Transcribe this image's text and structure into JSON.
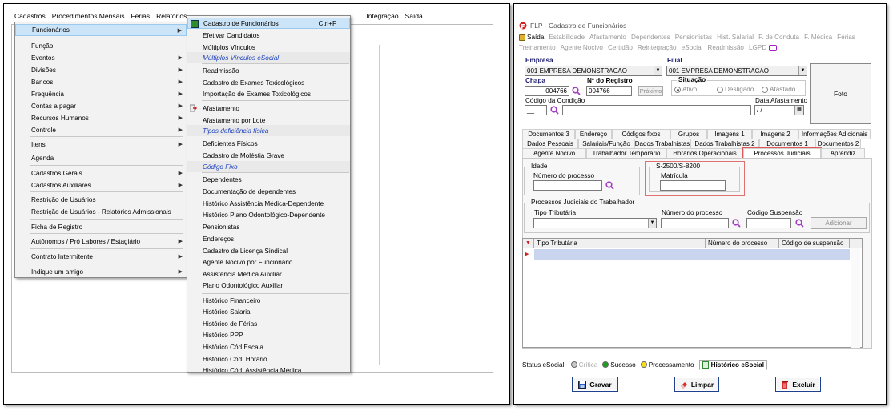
{
  "left_app": {
    "menubar": [
      "Cadastros",
      "Procedimentos Mensais",
      "Férias",
      "Relatórios",
      "Integração",
      "Saída"
    ],
    "menu1": [
      {
        "label": "Funcionários",
        "arrow": true,
        "selected": true
      },
      {
        "label": "Função"
      },
      {
        "label": "Eventos",
        "arrow": true
      },
      {
        "label": "Divisões",
        "arrow": true
      },
      {
        "label": "Bancos",
        "arrow": true
      },
      {
        "label": "Frequência",
        "arrow": true
      },
      {
        "label": "Contas a pagar",
        "arrow": true
      },
      {
        "label": "Recursos Humanos",
        "arrow": true
      },
      {
        "label": "Controle",
        "arrow": true
      },
      {
        "label": "Itens",
        "arrow": true
      },
      {
        "label": "Agenda"
      },
      {
        "label": "Cadastros Gerais",
        "arrow": true
      },
      {
        "label": "Cadastros Auxiliares",
        "arrow": true
      },
      {
        "label": "Restrição de Usuários"
      },
      {
        "label": "Restrição de Usuários - Relatórios Admissionais"
      },
      {
        "label": "Ficha de Registro"
      },
      {
        "label": "Autônomos / Pró Labores / Estagiário",
        "arrow": true
      },
      {
        "label": "Contrato Intermitente",
        "arrow": true
      },
      {
        "label": "Indique um amigo",
        "arrow": true
      }
    ],
    "menu2": [
      {
        "label": "Cadastro de Funcionários",
        "shortcut": "Ctrl+F",
        "selected": true
      },
      {
        "label": "Efetivar Candidatos"
      },
      {
        "label": "Múltiplos Vínculos"
      },
      {
        "label": "Múltiplos Vínculos eSocial",
        "italic": true
      },
      {
        "label": "Readmissão"
      },
      {
        "label": "Cadastro de Exames Toxicológicos"
      },
      {
        "label": "Importação de Exames Toxicológicos"
      },
      {
        "label": "Afastamento"
      },
      {
        "label": "Afastamento por Lote"
      },
      {
        "label": "Tipos deficiência física",
        "italic": true
      },
      {
        "label": "Deficientes Físicos"
      },
      {
        "label": "Cadastro de Moléstia Grave"
      },
      {
        "label": "Código Fixo",
        "italic": true
      },
      {
        "label": "Dependentes"
      },
      {
        "label": "Documentação de dependentes"
      },
      {
        "label": "Histórico Assistência Médica-Dependente"
      },
      {
        "label": "Histórico Plano Odontológico-Dependente"
      },
      {
        "label": "Pensionistas"
      },
      {
        "label": "Endereços"
      },
      {
        "label": "Cadastro de Licença Sindical"
      },
      {
        "label": "Agente Nocivo por Funcionário"
      },
      {
        "label": "Assistência Médica Auxiliar"
      },
      {
        "label": "Plano Odontológico Auxiliar"
      },
      {
        "label": "Histórico Financeiro"
      },
      {
        "label": "Histórico Salarial"
      },
      {
        "label": "Histórico de Férias"
      },
      {
        "label": "Histórico PPP"
      },
      {
        "label": "Histórico Cód.Escala"
      },
      {
        "label": "Histórico Cód. Horário"
      },
      {
        "label": "Histórico Cód. Assistência Médica"
      }
    ]
  },
  "right_app": {
    "title": "FLP - Cadastro de Funcionários",
    "toolbar": [
      "Saída",
      "Estabilidade",
      "Afastamento",
      "Dependentes",
      "Pensionistas",
      "Hist. Salarial",
      "F. de Conduta",
      "F. Médica",
      "Férias",
      "Treinamento",
      "Agente Nocivo",
      "Certidão",
      "Reintegração",
      "eSocial",
      "Readmissão",
      "LGPD"
    ],
    "empresa_label": "Empresa",
    "empresa_value": "001 EMPRESA DEMONSTRACAO",
    "filial_label": "Filial",
    "filial_value": "001 EMPRESA DEMONSTRACAO",
    "chapa_label": "Chapa",
    "chapa_value": "004766",
    "registro_label": "Nº do Registro",
    "registro_value": "004766",
    "proximo_label": "Próximo",
    "situacao_label": "Situação",
    "situacao_options": [
      "Ativo",
      "Desligado",
      "Afastado"
    ],
    "condicao_label": "Código da Condição",
    "condicao_value": "__",
    "data_afast_label": "Data Afastamento",
    "data_afast_value": "/ /",
    "foto_label": "Foto",
    "tabs_row1": [
      "Documentos 3",
      "Endereço",
      "Códigos fixos",
      "Grupos",
      "Imagens 1",
      "Imagens 2",
      "Informações Adicionais"
    ],
    "tabs_row2": [
      "Dados Pessoais",
      "Salariais/Função",
      "Dados Trabalhistas",
      "Dados Trabalhistas 2",
      "Documentos 1",
      "Documentos 2"
    ],
    "tabs_row3": [
      "Agente Nocivo",
      "Trabalhador Temporário",
      "Horários Operacionais",
      "Processos Judiciais",
      "Aprendiz"
    ],
    "idade_title": "Idade",
    "numero_processo_label": "Número do processo",
    "s2500_title": "S-2500/S-8200",
    "matricula_label": "Matrícula",
    "proc_jud_title": "Processos Judiciais do Trabalhador",
    "tipo_tributaria_label": "Tipo Tributária",
    "numero_processo2_label": "Número do processo",
    "codigo_suspensao_label": "Código Suspensão",
    "adicionar_label": "Adicionar",
    "grid_headers": [
      "Tipo Tributária",
      "Número do processo",
      "Código de suspensão"
    ],
    "status_label": "Status eSocial:",
    "status_items": [
      {
        "label": "Crítica",
        "color": "#c8c8c8",
        "muted": true
      },
      {
        "label": "Sucesso",
        "color": "#1e9e1e"
      },
      {
        "label": "Processamento",
        "color": "#f5e01a"
      }
    ],
    "historico_label": "Histórico eSocial",
    "buttons": {
      "gravar": "Gravar",
      "limpar": "Limpar",
      "excluir": "Excluir"
    }
  }
}
